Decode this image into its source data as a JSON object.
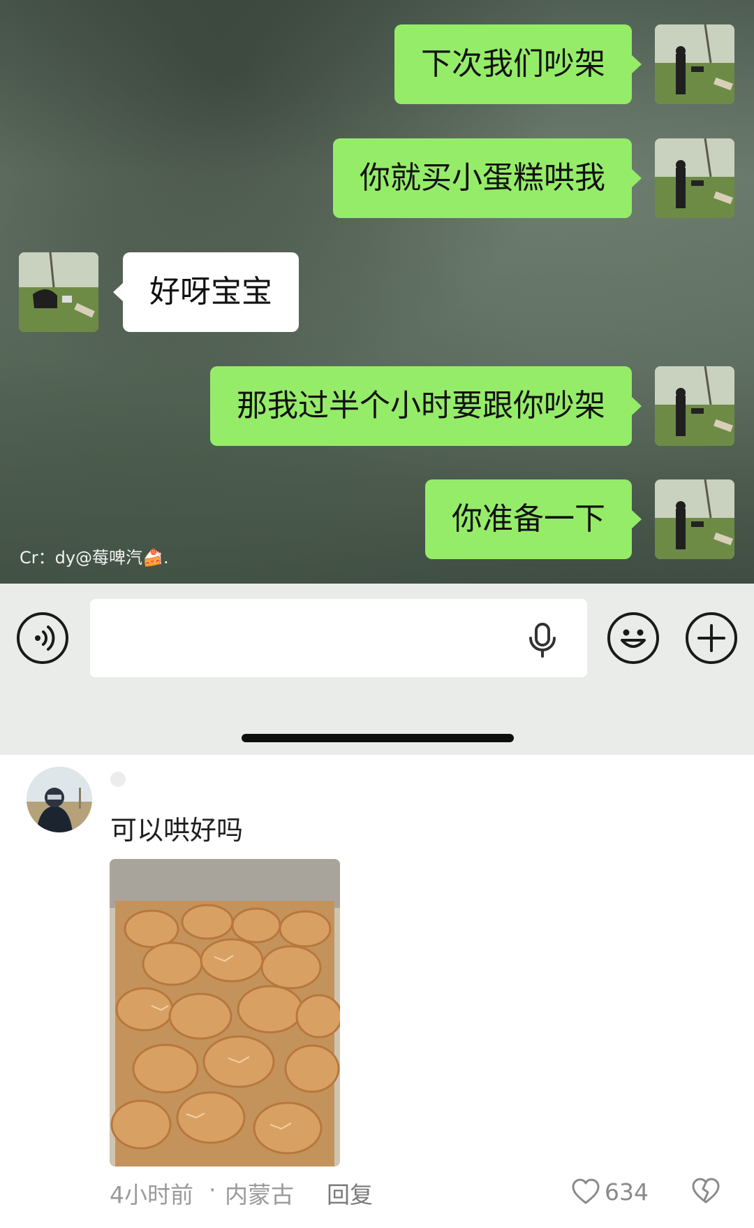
{
  "chat": {
    "messages": [
      {
        "sender": "me",
        "text": "下次我们吵架"
      },
      {
        "sender": "me",
        "text": "你就买小蛋糕哄我"
      },
      {
        "sender": "them",
        "text": "好呀宝宝"
      },
      {
        "sender": "me",
        "text": "那我过半个小时要跟你吵架"
      },
      {
        "sender": "me",
        "text": "你准备一下"
      }
    ],
    "credit": "Cr：dy@莓啤汽🍰.",
    "colors": {
      "bubble_me": "#95ec69",
      "bubble_them": "#ffffff"
    }
  },
  "input_bar": {
    "voice_icon": "voice-toggle-icon",
    "mic_icon": "microphone-icon",
    "emoji_icon": "emoji-icon",
    "plus_icon": "plus-icon"
  },
  "comment": {
    "text": "可以哄好吗",
    "time": "4小时前",
    "separator": "·",
    "location": "内蒙古",
    "reply_label": "回复",
    "like_count": "634",
    "like_icon": "heart-outline-icon",
    "dislike_icon": "broken-heart-icon",
    "image_icon": "bread-buns-photo"
  }
}
